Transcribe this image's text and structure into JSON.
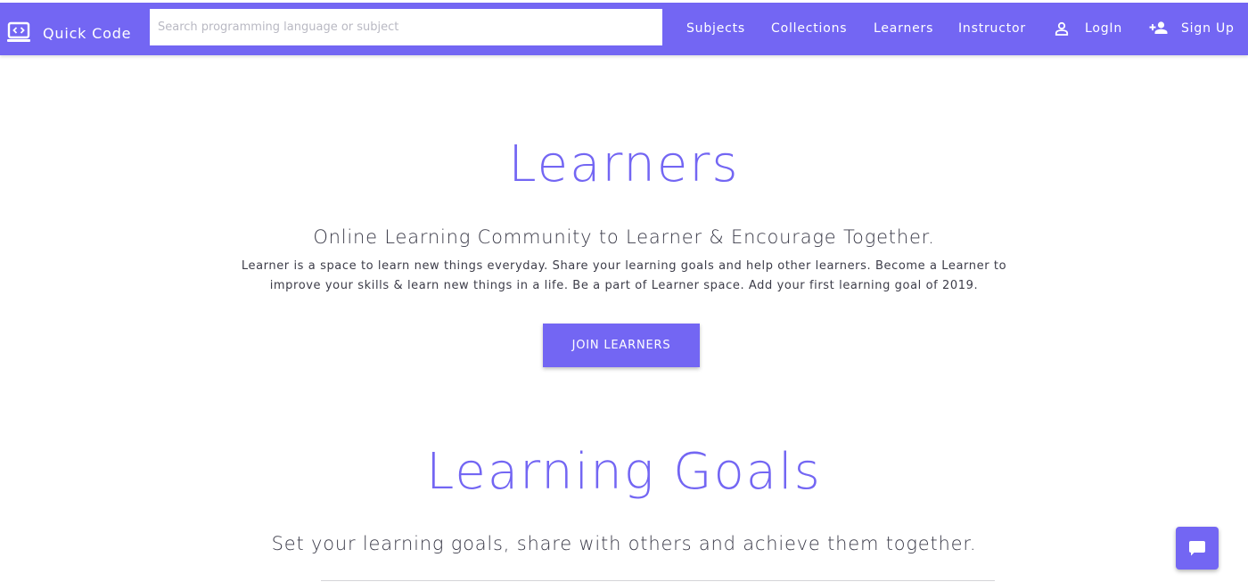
{
  "navbar": {
    "brand": "Quick Code",
    "brand_icon": "laptop-code-icon",
    "search": {
      "placeholder": "Search programming language or subject",
      "value": ""
    },
    "links": {
      "subjects": "Subjects",
      "collections": "Collections",
      "learners": "Learners",
      "instructor": "Instructor",
      "login": "LogIn",
      "signup": "Sign Up"
    },
    "login_icon": "person-icon",
    "signup_icon": "person-add-icon"
  },
  "hero": {
    "title": "Learners",
    "subtitle": "Online Learning Community to Learner & Encourage Together.",
    "description_lines": [
      "Learner is a space to learn new things everyday. Share your learning goals and help other learners. Become a Learner to",
      "improve your skills & learn new things in a life. Be a part of Learner space. Add your first learning goal of 2019."
    ],
    "cta": "JOIN LEARNERS"
  },
  "goals": {
    "title": "Learning Goals",
    "subtitle": "Set your learning goals, share with others and achieve them together."
  },
  "chat": {
    "icon": "chat-bubble-icon"
  },
  "colors": {
    "accent": "#7366f3",
    "text_dark": "#3a3a48",
    "background": "#ffffff"
  }
}
